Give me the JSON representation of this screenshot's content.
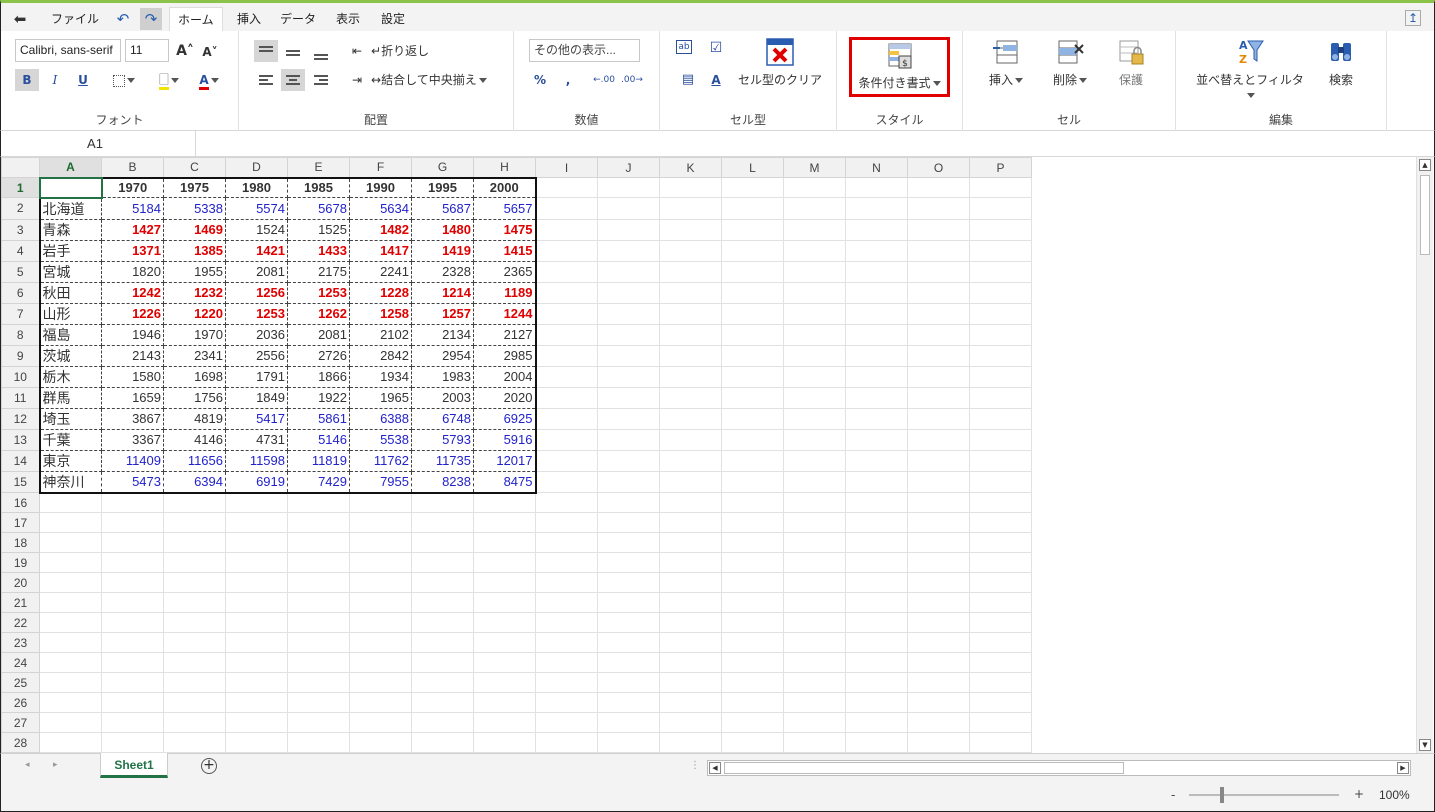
{
  "menu": {
    "file": "ファイル",
    "tabs": [
      "ホーム",
      "挿入",
      "データ",
      "表示",
      "設定"
    ]
  },
  "ribbon": {
    "font_name": "Calibri, sans-serif",
    "font_size": "11",
    "wrap_text": "折り返し",
    "merge_center": "結合して中央揃え",
    "number_format": "その他の表示...",
    "clear_celltype": "セル型のクリア",
    "conditional_format": "条件付き書式",
    "insert": "挿入",
    "delete": "削除",
    "protect": "保護",
    "sort_filter": "並べ替えとフィルタ",
    "find": "検索",
    "groups": {
      "font": "フォント",
      "alignment": "配置",
      "number": "数値",
      "celltype": "セル型",
      "style": "スタイル",
      "cells": "セル",
      "editing": "編集"
    },
    "highlight_color": "#e00000"
  },
  "formula_bar": {
    "name_box": "A1"
  },
  "grid": {
    "columns": [
      "A",
      "B",
      "C",
      "D",
      "E",
      "F",
      "G",
      "H",
      "I",
      "J",
      "K",
      "L",
      "M",
      "N",
      "O",
      "P"
    ],
    "row_count": 29,
    "header_row": [
      "",
      "1970",
      "1975",
      "1980",
      "1985",
      "1990",
      "1995",
      "2000"
    ],
    "rows": [
      {
        "label": "北海道",
        "values": [
          "5184",
          "5338",
          "5574",
          "5678",
          "5634",
          "5687",
          "5657"
        ],
        "style": [
          "blue",
          "blue",
          "blue",
          "blue",
          "blue",
          "blue",
          "blue"
        ]
      },
      {
        "label": "青森",
        "values": [
          "1427",
          "1469",
          "1524",
          "1525",
          "1482",
          "1480",
          "1475"
        ],
        "style": [
          "red",
          "red",
          "plain",
          "plain",
          "red",
          "red",
          "red"
        ]
      },
      {
        "label": "岩手",
        "values": [
          "1371",
          "1385",
          "1421",
          "1433",
          "1417",
          "1419",
          "1415"
        ],
        "style": [
          "red",
          "red",
          "red",
          "red",
          "red",
          "red",
          "red"
        ]
      },
      {
        "label": "宮城",
        "values": [
          "1820",
          "1955",
          "2081",
          "2175",
          "2241",
          "2328",
          "2365"
        ],
        "style": [
          "plain",
          "plain",
          "plain",
          "plain",
          "plain",
          "plain",
          "plain"
        ]
      },
      {
        "label": "秋田",
        "values": [
          "1242",
          "1232",
          "1256",
          "1253",
          "1228",
          "1214",
          "1189"
        ],
        "style": [
          "red",
          "red",
          "red",
          "red",
          "red",
          "red",
          "red"
        ]
      },
      {
        "label": "山形",
        "values": [
          "1226",
          "1220",
          "1253",
          "1262",
          "1258",
          "1257",
          "1244"
        ],
        "style": [
          "red",
          "red",
          "red",
          "red",
          "red",
          "red",
          "red"
        ]
      },
      {
        "label": "福島",
        "values": [
          "1946",
          "1970",
          "2036",
          "2081",
          "2102",
          "2134",
          "2127"
        ],
        "style": [
          "plain",
          "plain",
          "plain",
          "plain",
          "plain",
          "plain",
          "plain"
        ]
      },
      {
        "label": "茨城",
        "values": [
          "2143",
          "2341",
          "2556",
          "2726",
          "2842",
          "2954",
          "2985"
        ],
        "style": [
          "plain",
          "plain",
          "plain",
          "plain",
          "plain",
          "plain",
          "plain"
        ]
      },
      {
        "label": "栃木",
        "values": [
          "1580",
          "1698",
          "1791",
          "1866",
          "1934",
          "1983",
          "2004"
        ],
        "style": [
          "plain",
          "plain",
          "plain",
          "plain",
          "plain",
          "plain",
          "plain"
        ]
      },
      {
        "label": "群馬",
        "values": [
          "1659",
          "1756",
          "1849",
          "1922",
          "1965",
          "2003",
          "2020"
        ],
        "style": [
          "plain",
          "plain",
          "plain",
          "plain",
          "plain",
          "plain",
          "plain"
        ]
      },
      {
        "label": "埼玉",
        "values": [
          "3867",
          "4819",
          "5417",
          "5861",
          "6388",
          "6748",
          "6925"
        ],
        "style": [
          "plain",
          "plain",
          "blue",
          "blue",
          "blue",
          "blue",
          "blue"
        ]
      },
      {
        "label": "千葉",
        "values": [
          "3367",
          "4146",
          "4731",
          "5146",
          "5538",
          "5793",
          "5916"
        ],
        "style": [
          "plain",
          "plain",
          "plain",
          "blue",
          "blue",
          "blue",
          "blue"
        ]
      },
      {
        "label": "東京",
        "values": [
          "11409",
          "11656",
          "11598",
          "11819",
          "11762",
          "11735",
          "12017"
        ],
        "style": [
          "blue",
          "blue",
          "blue",
          "blue",
          "blue",
          "blue",
          "blue"
        ]
      },
      {
        "label": "神奈川",
        "values": [
          "5473",
          "6394",
          "6919",
          "7429",
          "7955",
          "8238",
          "8475"
        ],
        "style": [
          "blue",
          "blue",
          "blue",
          "blue",
          "blue",
          "blue",
          "blue"
        ]
      }
    ]
  },
  "sheet_tab": "Sheet1",
  "status": {
    "zoom_minus": "-",
    "zoom_plus": "+",
    "zoom": "100%"
  },
  "colors": {
    "blue_text": "#2222cc",
    "red_text": "#e00000",
    "accent": "#217346"
  }
}
